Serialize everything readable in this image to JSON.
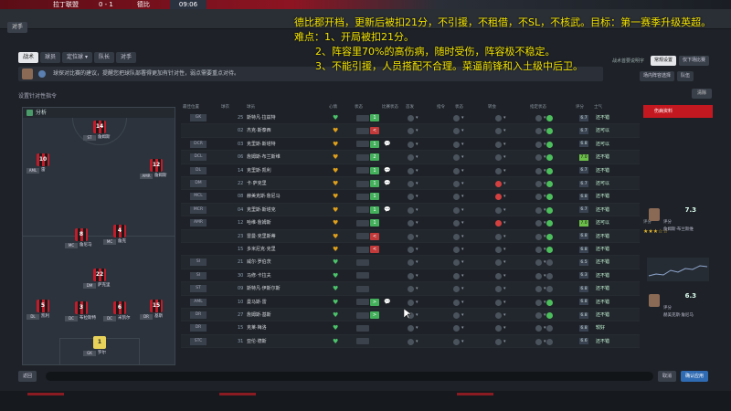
{
  "broadcast": {
    "left_text": "拉丁联盟",
    "score_text": "0 - 1",
    "clock": "09:06",
    "other_team": "德比"
  },
  "header": {
    "back_label": "对手"
  },
  "tabs": [
    {
      "label": "战术",
      "active": true
    },
    {
      "label": "球员",
      "active": false
    },
    {
      "label": "定位球 ▾",
      "active": false
    },
    {
      "label": "队长",
      "active": false
    },
    {
      "label": "对手",
      "active": false
    }
  ],
  "advice": {
    "text": "球探对比赛的建议，提醒您把球队部署得更加有针对性，弱点需要重点对待。"
  },
  "right_controls": {
    "label": "战术首要说明字",
    "btn1": "常规设置",
    "btn2": "仅下场比赛",
    "select1": "场内阵容选择",
    "select2": "队伍"
  },
  "sub_title": "设置针对性指令",
  "clear_label": "清除",
  "pitch": {
    "header": "分析",
    "players": [
      {
        "num": "14",
        "role": "ST",
        "name": "詹姆斯"
      },
      {
        "num": "10",
        "role": "AML",
        "name": "雷"
      },
      {
        "num": "12",
        "role": "AMR",
        "name": "詹姆斯"
      },
      {
        "num": "8",
        "role": "MC",
        "name": "詹尼马"
      },
      {
        "num": "4",
        "role": "MC",
        "name": "詹克"
      },
      {
        "num": "22",
        "role": "DM",
        "name": "萨克里"
      },
      {
        "num": "5",
        "role": "DL",
        "name": "凯利"
      },
      {
        "num": "3",
        "role": "DC",
        "name": "布拉斯特"
      },
      {
        "num": "6",
        "role": "DC",
        "name": "米凯尔"
      },
      {
        "num": "15",
        "role": "DR",
        "name": "基斯"
      },
      {
        "num": "1",
        "role": "GK",
        "name": "罗尔"
      }
    ]
  },
  "table": {
    "headers": [
      "最佳位置",
      "球衣",
      "球员",
      "心情",
      "状态",
      "比赛状态",
      "首发",
      "指令",
      "状态",
      "转会",
      "指定状态",
      "评分",
      "士气"
    ],
    "rows": [
      {
        "pos": "GK",
        "num": "25",
        "name": "斯特凡·拉兹特",
        "heart": "g",
        "badge": "g",
        "b": "1",
        "chat": "",
        "rating": "6.7",
        "rhi": false,
        "morale": "还不错",
        "d1": "n",
        "d2": "n",
        "d3": "n",
        "d4": "n",
        "d5": "g"
      },
      {
        "pos": "",
        "num": "02",
        "name": "杰克·斯泰西",
        "heart": "y",
        "badge": "r",
        "b": "<",
        "chat": "",
        "rating": "6.7",
        "rhi": false,
        "morale": "还可以",
        "d1": "n",
        "d2": "n",
        "d3": "n",
        "d4": "n",
        "d5": "g"
      },
      {
        "pos": "DCR",
        "num": "03",
        "name": "克里斯·斯塔特",
        "heart": "y",
        "badge": "g",
        "b": "1",
        "chat": "💬",
        "rating": "6.8",
        "rhi": false,
        "morale": "还可以",
        "d1": "n",
        "d2": "n",
        "d3": "n",
        "d4": "n",
        "d5": "g"
      },
      {
        "pos": "DCL",
        "num": "06",
        "name": "詹姆斯·布兰斯维",
        "heart": "y",
        "badge": "g",
        "b": "2",
        "chat": "",
        "rating": "7.0",
        "rhi": true,
        "morale": "还不错",
        "d1": "n",
        "d2": "n",
        "d3": "n",
        "d4": "n",
        "d5": "g"
      },
      {
        "pos": "DL",
        "num": "14",
        "name": "克里斯·凯利",
        "heart": "y",
        "badge": "g",
        "b": "1",
        "chat": "💬",
        "rating": "6.7",
        "rhi": false,
        "morale": "还不错",
        "d1": "n",
        "d2": "n",
        "d3": "n",
        "d4": "n",
        "d5": "g"
      },
      {
        "pos": "DM",
        "num": "22",
        "name": "卡·萨克里",
        "heart": "y",
        "badge": "g",
        "b": "1",
        "chat": "💬",
        "rating": "6.7",
        "rhi": false,
        "morale": "还可以",
        "d1": "n",
        "d2": "n",
        "d3": "r",
        "d4": "n",
        "d5": "g"
      },
      {
        "pos": "MCL",
        "num": "08",
        "name": "赫美克斯·詹尼马",
        "heart": "y",
        "badge": "g",
        "b": "1",
        "chat": "",
        "rating": "6.8",
        "rhi": false,
        "morale": "还不错",
        "d1": "n",
        "d2": "n",
        "d3": "r",
        "d4": "n",
        "d5": "g"
      },
      {
        "pos": "MCR",
        "num": "04",
        "name": "克里斯·斯塔克",
        "heart": "y",
        "badge": "g",
        "b": "1",
        "chat": "💬",
        "rating": "6.7",
        "rhi": false,
        "morale": "还不错",
        "d1": "n",
        "d2": "n",
        "d3": "n",
        "d4": "n",
        "d5": "g"
      },
      {
        "pos": "AMR",
        "num": "12",
        "name": "哈维·詹姆斯",
        "heart": "y",
        "badge": "g",
        "b": "1",
        "chat": "",
        "rating": "7.0",
        "rhi": true,
        "morale": "还可以",
        "d1": "n",
        "d2": "n",
        "d3": "r",
        "d4": "n",
        "d5": "g"
      },
      {
        "pos": "",
        "num": "23",
        "name": "雷曼·克里斯蒂",
        "heart": "y",
        "badge": "r",
        "b": "<",
        "chat": "",
        "rating": "6.8",
        "rhi": false,
        "morale": "还不错",
        "d1": "n",
        "d2": "n",
        "d3": "n",
        "d4": "n",
        "d5": "g"
      },
      {
        "pos": "",
        "num": "15",
        "name": "多米尼克·克里",
        "heart": "y",
        "badge": "r",
        "b": "<",
        "chat": "",
        "rating": "6.8",
        "rhi": false,
        "morale": "还不错",
        "d1": "n",
        "d2": "n",
        "d3": "n",
        "d4": "n",
        "d5": "g"
      },
      {
        "pos": "SI",
        "num": "21",
        "name": "威尔·罗伯茨",
        "heart": "g",
        "badge": "n",
        "b": "",
        "chat": "",
        "rating": "6.5",
        "rhi": false,
        "morale": "还不错",
        "d1": "n",
        "d2": "n",
        "d3": "n",
        "d4": "n",
        "d5": "n"
      },
      {
        "pos": "SI",
        "num": "30",
        "name": "马修·卡拉夫",
        "heart": "g",
        "badge": "n",
        "b": "",
        "chat": "",
        "rating": "6.3",
        "rhi": false,
        "morale": "还不错",
        "d1": "n",
        "d2": "n",
        "d3": "n",
        "d4": "n",
        "d5": "n"
      },
      {
        "pos": "ST",
        "num": "09",
        "name": "斯特凡·伊斯尔斯",
        "heart": "g",
        "badge": "n",
        "b": "",
        "chat": "",
        "rating": "6.8",
        "rhi": false,
        "morale": "还不错",
        "d1": "n",
        "d2": "n",
        "d3": "n",
        "d4": "n",
        "d5": "n"
      },
      {
        "pos": "AML",
        "num": "10",
        "name": "曼马斯·雷",
        "heart": "g",
        "badge": "g",
        "b": ">",
        "chat": "💬",
        "rating": "6.8",
        "rhi": false,
        "morale": "还不错",
        "d1": "n",
        "d2": "n",
        "d3": "n",
        "d4": "n",
        "d5": "g"
      },
      {
        "pos": "DR",
        "num": "27",
        "name": "詹姆斯·基斯",
        "heart": "g",
        "badge": "g",
        "b": ">",
        "chat": "",
        "rating": "6.8",
        "rhi": false,
        "morale": "还不错",
        "d1": "n",
        "d2": "n",
        "d3": "n",
        "d4": "n",
        "d5": "g"
      },
      {
        "pos": "DR",
        "num": "15",
        "name": "克莱·梅洛",
        "heart": "g",
        "badge": "n",
        "b": "",
        "chat": "",
        "rating": "6.8",
        "rhi": false,
        "morale": "较好",
        "d1": "n",
        "d2": "n",
        "d3": "n",
        "d4": "n",
        "d5": "n"
      },
      {
        "pos": "STC",
        "num": "31",
        "name": "亚伦·德斯",
        "heart": "g",
        "badge": "n",
        "b": "",
        "chat": "",
        "rating": "6.6",
        "rhi": false,
        "morale": "还不错",
        "d1": "n",
        "d2": "n",
        "d3": "n",
        "d4": "n",
        "d5": "n"
      }
    ]
  },
  "right_panel": {
    "red_label": "伤病资料",
    "label1": "评分",
    "stars": "★★★☆☆",
    "card1": {
      "score": "7.3",
      "sub": "评分",
      "name": "詹姆斯·布兰斯维"
    },
    "card2": {
      "score": "6.3",
      "sub": "评分",
      "name": "赫美克斯·詹尼马"
    }
  },
  "footer": {
    "left_btn": "返回",
    "cancel": "取消",
    "confirm": "确认应用"
  },
  "overlay": {
    "line1": "德比郡开档，更新后被扣21分，不引援，不租借，不SL，不核武。目标：第一赛季升级英超。",
    "line2": "难点：1、开局被扣21分。",
    "line3": "2、阵容里70%的高伤病，随时受伤，阵容极不稳定。",
    "line4": "3、不能引援，人员搭配不合理。菜逼前锋和入土级中后卫。"
  },
  "colors": {
    "accent_red": "#c41820",
    "overlay_yellow": "#f4e400",
    "good_green": "#4cbf5c"
  }
}
